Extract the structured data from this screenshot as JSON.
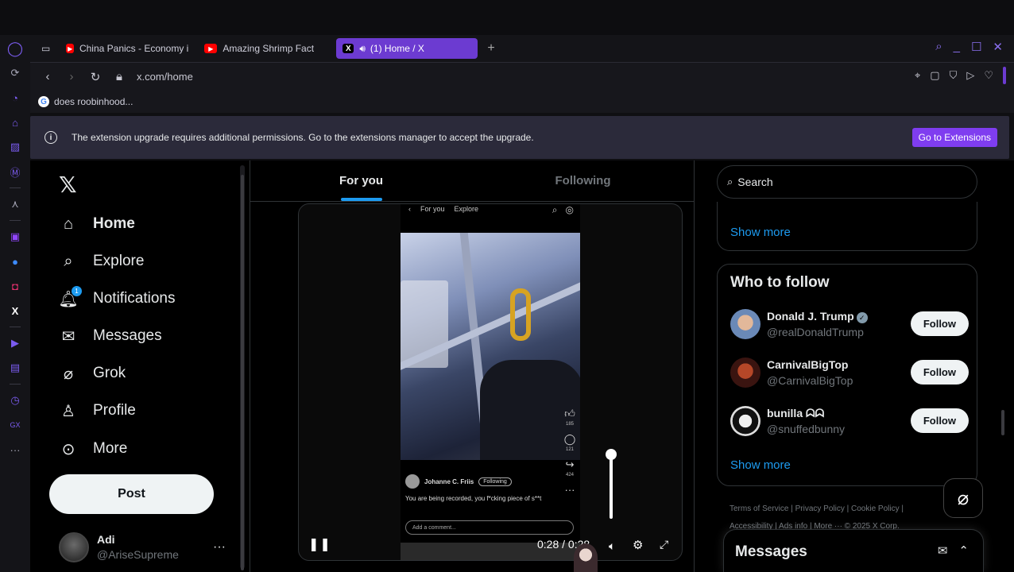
{
  "tabs": [
    {
      "title": "China Panics - Economy i",
      "icon": "youtube"
    },
    {
      "title": "Amazing Shrimp Fact",
      "icon": "youtube"
    },
    {
      "title": "(1) Home / X",
      "icon": "x",
      "active": true
    }
  ],
  "address": {
    "url": "x.com/home"
  },
  "bookmark": {
    "label": "does roobinhood..."
  },
  "notice": {
    "text": "The extension upgrade requires additional permissions. Go to the extensions manager to accept the upgrade.",
    "button": "Go to Extensions"
  },
  "nav": {
    "items": [
      {
        "label": "Home",
        "icon": "home-icon"
      },
      {
        "label": "Explore",
        "icon": "search-icon"
      },
      {
        "label": "Notifications",
        "icon": "bell-icon",
        "badge": "1"
      },
      {
        "label": "Messages",
        "icon": "envelope-icon"
      },
      {
        "label": "Grok",
        "icon": "grok-icon"
      },
      {
        "label": "Profile",
        "icon": "person-icon"
      },
      {
        "label": "More",
        "icon": "more-circle-icon"
      }
    ],
    "post": "Post",
    "account": {
      "name": "Adi",
      "handle": "@AriseSupreme"
    }
  },
  "feed": {
    "tabs": [
      "For you",
      "Following"
    ],
    "video": {
      "top_tabs": [
        "For you",
        "Explore"
      ],
      "counts": [
        "185",
        "121",
        "424"
      ],
      "poster": "Johanne C. Friis",
      "follow": "Following",
      "caption": "You are being recorded, you f*cking piece of s**t",
      "comment_placeholder": "Add a comment...",
      "time": "0:28 / 0:28",
      "volume_level": 0.85
    }
  },
  "right": {
    "search_placeholder": "Search",
    "show_more": "Show more",
    "wtf_title": "Who to follow",
    "follow_label": "Follow",
    "suggestions": [
      {
        "name": "Donald J. Trump",
        "handle": "@realDonaldTrump",
        "verified": true,
        "avatar_color": "#c79273"
      },
      {
        "name": "CarnivalBigTop",
        "handle": "@CarnivalBigTop",
        "verified": false,
        "avatar_color": "#7a2a1a"
      },
      {
        "name": "bunilla ᗣᗣ",
        "handle": "@snuffedbunny",
        "verified": false,
        "avatar_color": "#d8d8d8"
      }
    ],
    "footer_line1": "Terms of Service  |  Privacy Policy  |  Cookie Policy  |",
    "footer_line2": "Accessibility  |  Ads info  |  More ···  © 2025 X Corp.",
    "messages_title": "Messages"
  },
  "colors": {
    "accent": "#1d9bf0",
    "opera": "#6c3bd1",
    "ext_button": "#7f3df0"
  }
}
